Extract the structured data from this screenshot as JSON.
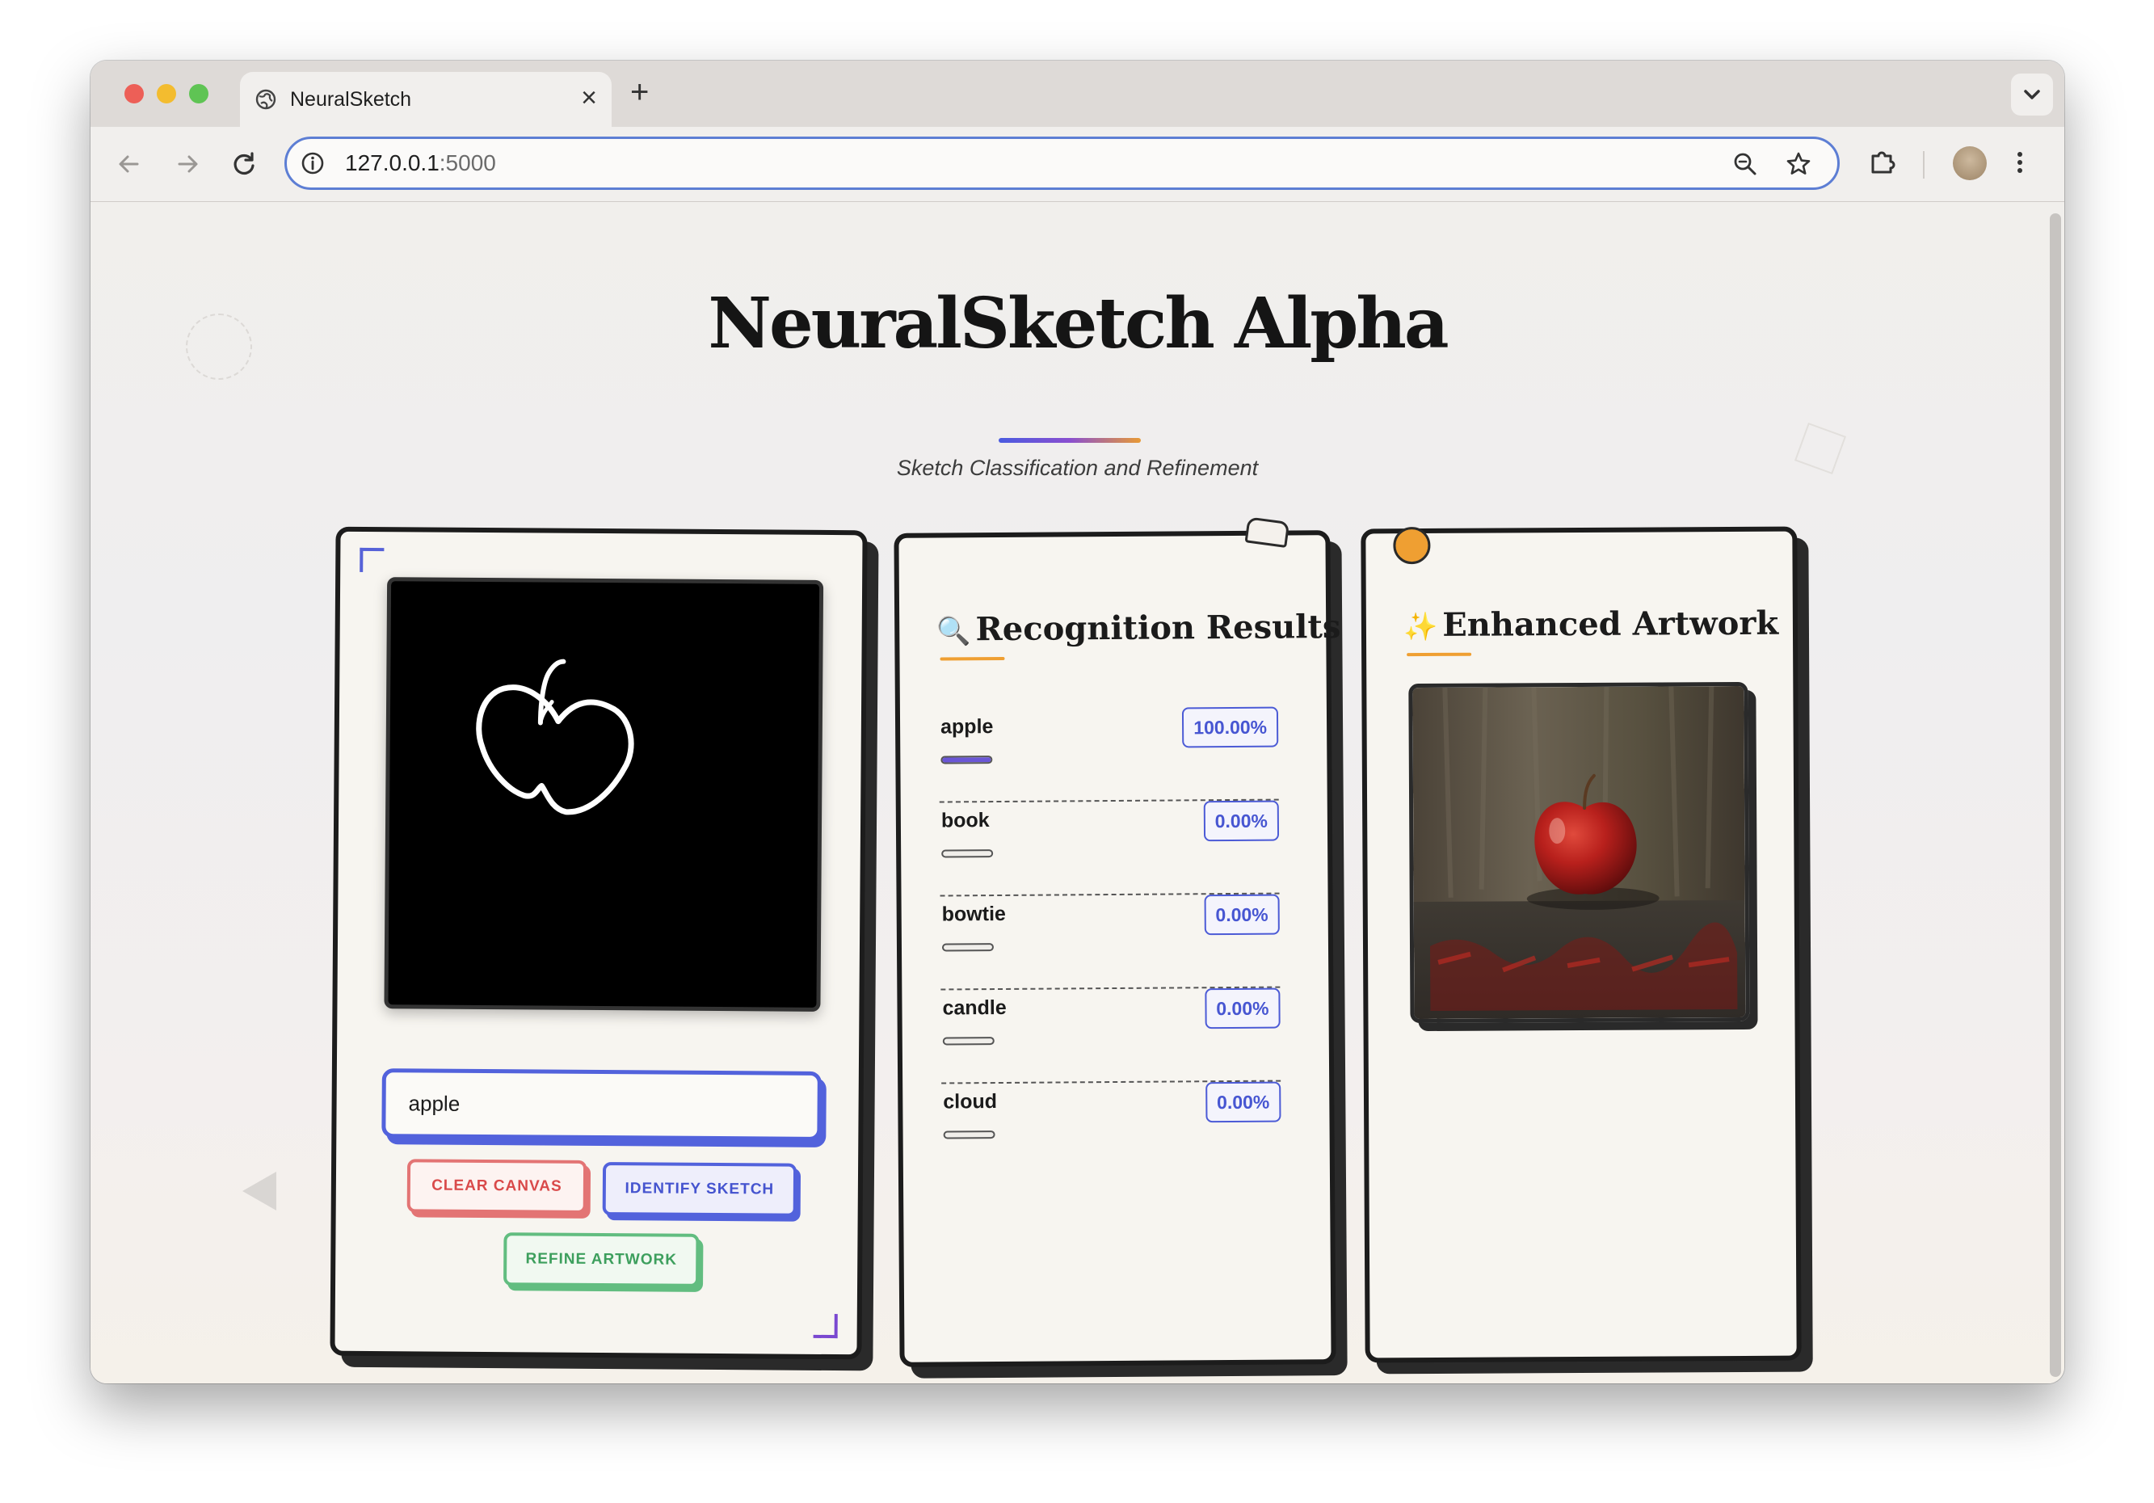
{
  "browser": {
    "tab_title": "NeuralSketch",
    "url_host": "127.0.0.1",
    "url_port": ":5000",
    "new_tab_symbol": "+",
    "close_symbol": "×"
  },
  "page": {
    "title": "NeuralSketch Alpha",
    "subtitle": "Sketch Classification and Refinement"
  },
  "sketch_panel": {
    "label_value": "apple",
    "clear_label": "CLEAR CANVAS",
    "identify_label": "IDENTIFY SKETCH",
    "refine_label": "REFINE ARTWORK"
  },
  "results_panel": {
    "icon": "🔍",
    "heading": "Recognition Results",
    "results": [
      {
        "label": "apple",
        "percent": "100.00%",
        "fraction": 1.0
      },
      {
        "label": "book",
        "percent": "0.00%",
        "fraction": 0.0
      },
      {
        "label": "bowtie",
        "percent": "0.00%",
        "fraction": 0.0
      },
      {
        "label": "candle",
        "percent": "0.00%",
        "fraction": 0.0
      },
      {
        "label": "cloud",
        "percent": "0.00%",
        "fraction": 0.0
      }
    ]
  },
  "artwork_panel": {
    "icon": "✨",
    "heading": "Enhanced Artwork"
  },
  "colors": {
    "accent_blue": "#5262dc",
    "accent_red": "#e37474",
    "accent_green": "#62bd80",
    "accent_orange": "#ef9f32",
    "progress_fill": "#6a56d6"
  },
  "icons": [
    "globe-icon",
    "close-icon",
    "plus-icon",
    "chevron-down-icon",
    "back-arrow-icon",
    "forward-arrow-icon",
    "reload-icon",
    "info-icon",
    "zoom-icon",
    "star-icon",
    "extensions-icon",
    "avatar",
    "more-vertical-icon"
  ]
}
